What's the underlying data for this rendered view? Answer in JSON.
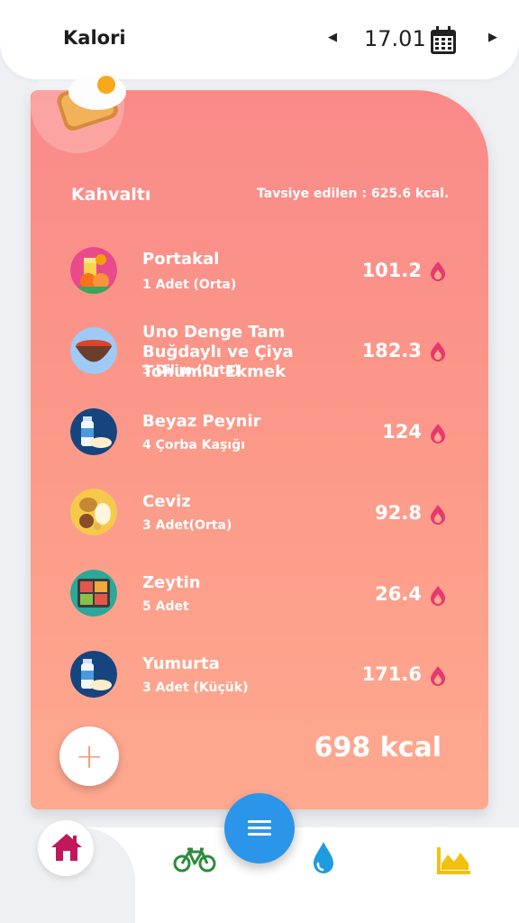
{
  "header": {
    "title": "Kalori",
    "date": "17.01",
    "prev_label": "◀",
    "next_label": "▶"
  },
  "meal": {
    "name": "Kahvaltı",
    "recommended": "Tavsiye edilen : 625.6 kcal.",
    "foods": [
      {
        "name": "Portakal",
        "portion": "1 Adet (Orta)",
        "calories": "101.2",
        "icon": "orange-juice-icon"
      },
      {
        "name": "Uno Denge Tam Buğdaylı ve Çiya Tohumlu Ekmek",
        "portion": "3 Dilim (Orta)",
        "calories": "182.3",
        "icon": "soup-bowl-icon"
      },
      {
        "name": "Beyaz Peynir",
        "portion": "4 Çorba Kaşığı",
        "calories": "124",
        "icon": "milk-bottle-icon"
      },
      {
        "name": "Ceviz",
        "portion": "3 Adet(Orta)",
        "calories": "92.8",
        "icon": "nuts-icon"
      },
      {
        "name": "Zeytin",
        "portion": "5 Adet",
        "calories": "26.4",
        "icon": "lunchbox-icon"
      },
      {
        "name": "Yumurta",
        "portion": "3 Adet (Küçük)",
        "calories": "171.6",
        "icon": "milk-bottle-icon"
      }
    ],
    "add_label": "+",
    "total": "698 kcal"
  },
  "colors": {
    "card_top": "#fa8a8a",
    "card_bottom": "#ffa98f",
    "flame": "#e8386e",
    "fab": "#2b95ea",
    "home": "#c2185b",
    "bike": "#2e8b3e",
    "drop": "#1e9be0",
    "chart": "#f2c10f"
  },
  "bottom_nav": {
    "items": [
      "home-icon",
      "bike-icon",
      "water-drop-icon",
      "chart-icon"
    ]
  }
}
